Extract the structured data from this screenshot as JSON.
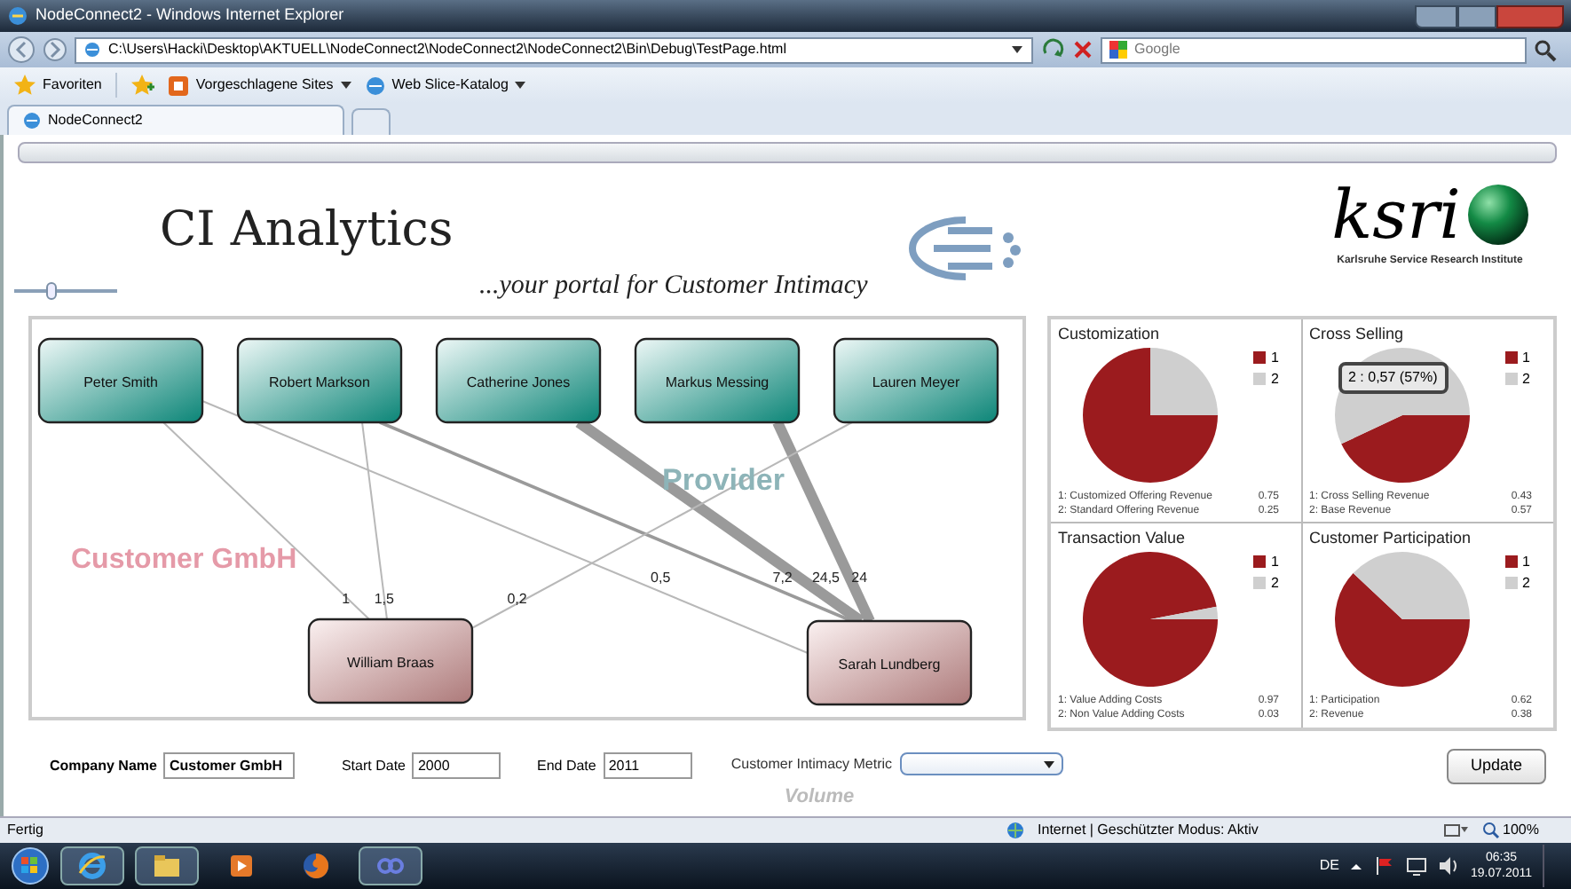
{
  "window": {
    "title": "NodeConnect2 - Windows Internet Explorer"
  },
  "address_bar": {
    "url": "C:\\Users\\Hacki\\Desktop\\AKTUELL\\NodeConnect2\\NodeConnect2\\NodeConnect2\\Bin\\Debug\\TestPage.html",
    "search_placeholder": "Google"
  },
  "favorites_bar": {
    "favorites": "Favoriten",
    "items": [
      {
        "label": "Vorgeschlagene Sites"
      },
      {
        "label": "Web Slice-Katalog"
      }
    ]
  },
  "tabs": [
    {
      "label": "NodeConnect2",
      "selected": true
    }
  ],
  "progress_bar": {
    "level": 0
  },
  "app": {
    "title": "CI Analytics",
    "tagline": "...your portal for Customer Intimacy",
    "logo_text": "ksri",
    "logo_caption": "Karlsruhe Service Research Institute",
    "zoom_slider": {
      "level": 0.35
    }
  },
  "diagram": {
    "providers_label": "Provider",
    "customer_label": "Customer GmbH",
    "customers": [
      "William Braas",
      "Sarah Lundberg"
    ],
    "providers": [
      {
        "name": "Peter Smith",
        "links": [
          {
            "kind": "left",
            "label": "1"
          },
          {
            "kind": "right",
            "label": "0,5"
          }
        ]
      },
      {
        "name": "Robert Markson",
        "links": [
          {
            "kind": "left",
            "label": "1,5"
          },
          {
            "kind": "right",
            "label": "7,2"
          }
        ]
      },
      {
        "name": "Catherine Jones",
        "links": [
          {
            "kind": "right",
            "label": "24,5"
          }
        ]
      },
      {
        "name": "Markus Messing",
        "links": [
          {
            "kind": "right",
            "label": "24"
          }
        ]
      },
      {
        "name": "Lauren Meyer",
        "links": [
          {
            "kind": "left",
            "label": "0,2"
          }
        ]
      }
    ]
  },
  "charts": [
    {
      "title": "Customization",
      "chart_data": {
        "type": "pie",
        "legend": "right",
        "categories": [
          "1",
          "2"
        ],
        "colors": [
          "#9b1b1e",
          "#cfcfcf"
        ],
        "values": [
          0.75,
          0.25
        ]
      },
      "footnotes": [
        {
          "label": "1: Customized Offering Revenue",
          "value": "0.75"
        },
        {
          "label": "2: Standard Offering Revenue",
          "value": "0.25"
        }
      ]
    },
    {
      "title": "Cross Selling",
      "tooltip": "2 : 0,57 (57%)",
      "chart_data": {
        "type": "pie",
        "legend": "right",
        "categories": [
          "1",
          "2"
        ],
        "colors": [
          "#9b1b1e",
          "#cfcfcf"
        ],
        "values": [
          0.43,
          0.57
        ]
      },
      "footnotes": [
        {
          "label": "1: Cross Selling Revenue",
          "value": "0.43"
        },
        {
          "label": "2: Base Revenue",
          "value": "0.57"
        }
      ]
    },
    {
      "title": "Transaction Value",
      "chart_data": {
        "type": "pie",
        "legend": "right",
        "categories": [
          "1",
          "2"
        ],
        "colors": [
          "#9b1b1e",
          "#cfcfcf"
        ],
        "values": [
          0.97,
          0.03
        ]
      },
      "footnotes": [
        {
          "label": "1: Value Adding Costs",
          "value": "0.97"
        },
        {
          "label": "2: Non Value Adding Costs",
          "value": "0.03"
        }
      ]
    },
    {
      "title": "Customer Participation",
      "chart_data": {
        "type": "pie",
        "legend": "right",
        "categories": [
          "1",
          "2"
        ],
        "colors": [
          "#9b1b1e",
          "#cfcfcf"
        ],
        "values": [
          0.62,
          0.38
        ]
      },
      "footnotes": [
        {
          "label": "1: Participation",
          "value": "0.62"
        },
        {
          "label": "2: Revenue",
          "value": "0.38"
        }
      ]
    }
  ],
  "form": {
    "company_name": {
      "label": "Company Name",
      "value": "Customer GmbH"
    },
    "start_date": {
      "label": "Start Date",
      "value": "2000"
    },
    "end_date": {
      "label": "End Date",
      "value": "2011"
    },
    "metric": {
      "label": "Customer Intimacy Metric"
    },
    "metric_caption": "Volume",
    "update_button": "Update"
  },
  "status_bar": {
    "text": "Fertig",
    "zone": "Internet | Geschützter Modus: Aktiv",
    "zoom": "100%"
  },
  "taskbar": {
    "language": "DE",
    "time": "06:35",
    "date": "19.07.2011"
  }
}
